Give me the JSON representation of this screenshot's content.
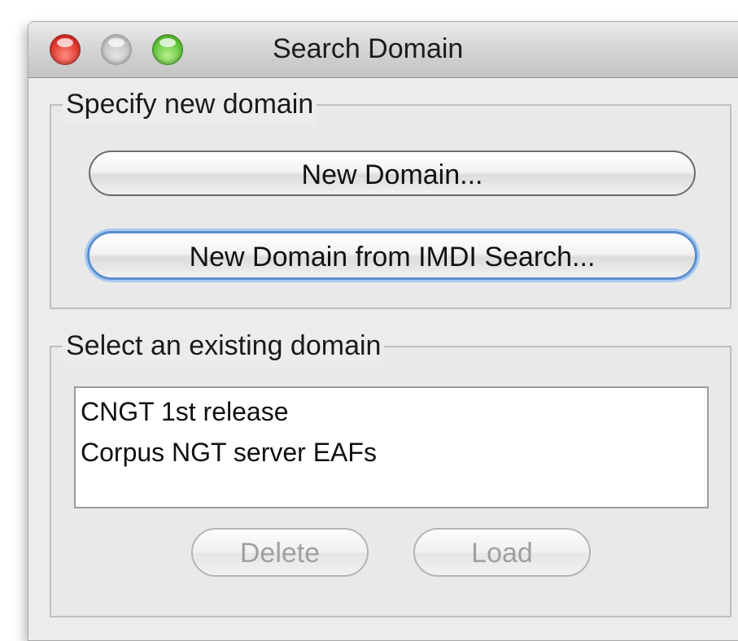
{
  "window": {
    "title": "Search Domain"
  },
  "specify_group": {
    "legend": "Specify new domain",
    "new_domain_label": "New Domain...",
    "imdi_search_label": "New Domain from IMDI Search..."
  },
  "existing_group": {
    "legend": "Select an existing domain",
    "domains": [
      "CNGT 1st release",
      "Corpus NGT server EAFs"
    ],
    "delete_label": "Delete",
    "load_label": "Load"
  },
  "colors": {
    "window_bg": "#ececec",
    "focus_ring": "#5b8fce",
    "close_light": "#e0362d",
    "minimize_light": "#c3c3c3",
    "zoom_light": "#62c43b",
    "disabled_text": "#a0a0a0"
  }
}
